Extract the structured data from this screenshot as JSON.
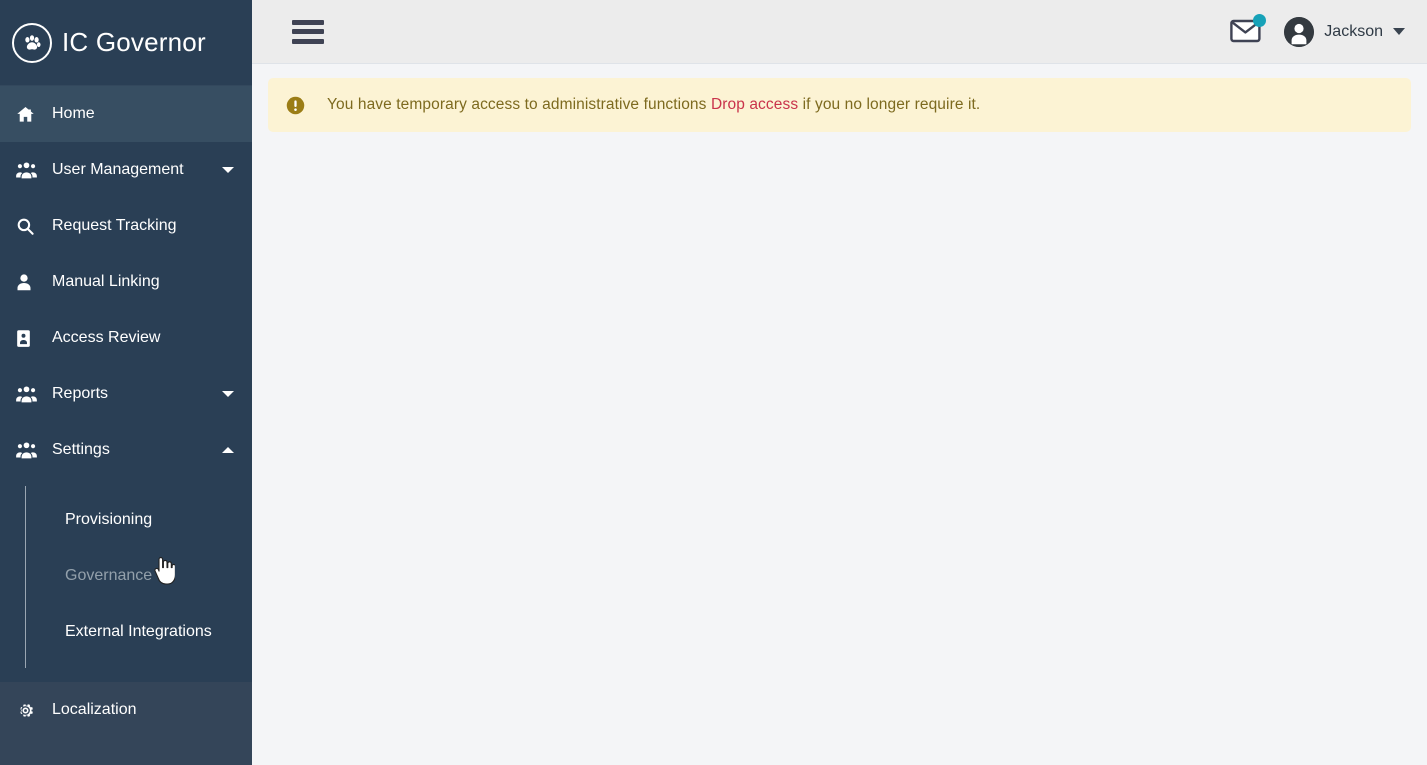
{
  "brand": {
    "title": "IC Governor",
    "logo_icon": "paw-circle-icon"
  },
  "sidebar": {
    "items": [
      {
        "label": "Home",
        "icon": "home-icon",
        "state": "active",
        "expandable": false
      },
      {
        "label": "User Management",
        "icon": "users-group-icon",
        "state": "default",
        "expandable": true,
        "caret": "chevron-down-icon"
      },
      {
        "label": "Request Tracking",
        "icon": "search-icon",
        "state": "default",
        "expandable": false
      },
      {
        "label": "Manual Linking",
        "icon": "user-icon",
        "state": "default",
        "expandable": false
      },
      {
        "label": "Access Review",
        "icon": "id-card-icon",
        "state": "default",
        "expandable": false
      },
      {
        "label": "Reports",
        "icon": "users-group-icon",
        "state": "default",
        "expandable": true,
        "caret": "chevron-down-icon"
      },
      {
        "label": "Settings",
        "icon": "users-group-icon",
        "state": "expanded",
        "expandable": true,
        "caret": "chevron-up-icon"
      }
    ],
    "settings_submenu": [
      {
        "label": "Provisioning",
        "state": "default"
      },
      {
        "label": "Governance",
        "state": "hover"
      },
      {
        "label": "External Integrations",
        "state": "default"
      }
    ],
    "tail_item": {
      "label": "Localization",
      "icon": "gear-icon"
    }
  },
  "topbar": {
    "menu_toggle_icon": "hamburger-icon",
    "mail_icon": "envelope-icon",
    "mail_badge_color": "#17a2b8",
    "avatar_icon": "user-avatar-icon",
    "user_name": "Jackson",
    "user_caret_icon": "chevron-down-icon"
  },
  "alert": {
    "icon": "exclamation-circle-icon",
    "text_before": "You have temporary access to administrative functions",
    "link_text": "Drop access",
    "text_after": "if you no longer require it.",
    "background": "#fcf3d4",
    "text_color": "#7d6a1f",
    "link_color": "#c9334b"
  },
  "theme": {
    "sidebar_bg": "#2a3f55",
    "sidebar_active_bg": "#374e62",
    "sidebar_tail_bg": "#344559",
    "topbar_bg": "#ececec",
    "content_bg": "#f4f5f7"
  },
  "cursor": {
    "type": "pointer-hand-cursor"
  }
}
